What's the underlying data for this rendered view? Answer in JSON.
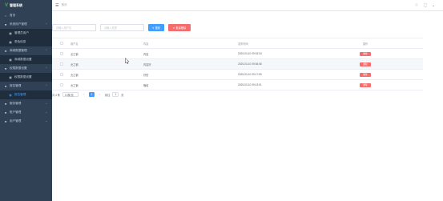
{
  "app": {
    "logo_mark": "V",
    "logo_text": "管理系统"
  },
  "sidebar": {
    "items": [
      {
        "label": "首页",
        "icon": "home-icon"
      },
      {
        "label": "系统用户管理",
        "icon": "user-icon",
        "expanded": true,
        "children": [
          {
            "label": "管理员用户"
          },
          {
            "label": "角色信息"
          }
        ]
      },
      {
        "label": "商城数据管理",
        "icon": "shop-icon",
        "expanded": true,
        "children": [
          {
            "label": "商城数据设置"
          }
        ]
      },
      {
        "label": "权限数据设置",
        "icon": "lock-icon",
        "expanded": true,
        "children": [
          {
            "label": "权限数据设置"
          }
        ]
      },
      {
        "label": "报告管理",
        "icon": "report-icon",
        "expanded": true,
        "children": [
          {
            "label": "报告管理",
            "active": true
          }
        ]
      },
      {
        "label": "服务管理",
        "icon": "service-icon"
      },
      {
        "label": "账户管理",
        "icon": "account-icon"
      },
      {
        "label": "用户管理",
        "icon": "people-icon"
      }
    ]
  },
  "topbar": {
    "breadcrumb": "首页"
  },
  "filters": {
    "input1_placeholder": "请输入用户名",
    "input2_placeholder": "请输入类型",
    "search_label": "搜索",
    "batch_delete_label": "批量删除"
  },
  "table": {
    "headers": [
      "用户名",
      "内容",
      "发布时间",
      "操作"
    ],
    "rows": [
      {
        "user": "允之钢",
        "content": "内容",
        "time": "2025-03-10 09:33:34",
        "action": "删除"
      },
      {
        "user": "允之钢",
        "content": "内容好",
        "time": "2025-03-10 09:36:08",
        "action": "删除"
      },
      {
        "user": "允之钢",
        "content": "好的",
        "time": "2025-03-10 09:17:59",
        "action": "删除"
      },
      {
        "user": "允之钢",
        "content": "嗨哈",
        "time": "2025-03-10 09:13:01",
        "action": "删除"
      }
    ]
  },
  "pagination": {
    "total_text": "共 4 条",
    "page_size": "10条/页",
    "prev": "<",
    "current": "1",
    "next": ">",
    "goto_label": "前往",
    "goto_value": "1",
    "page_suffix": "页"
  }
}
